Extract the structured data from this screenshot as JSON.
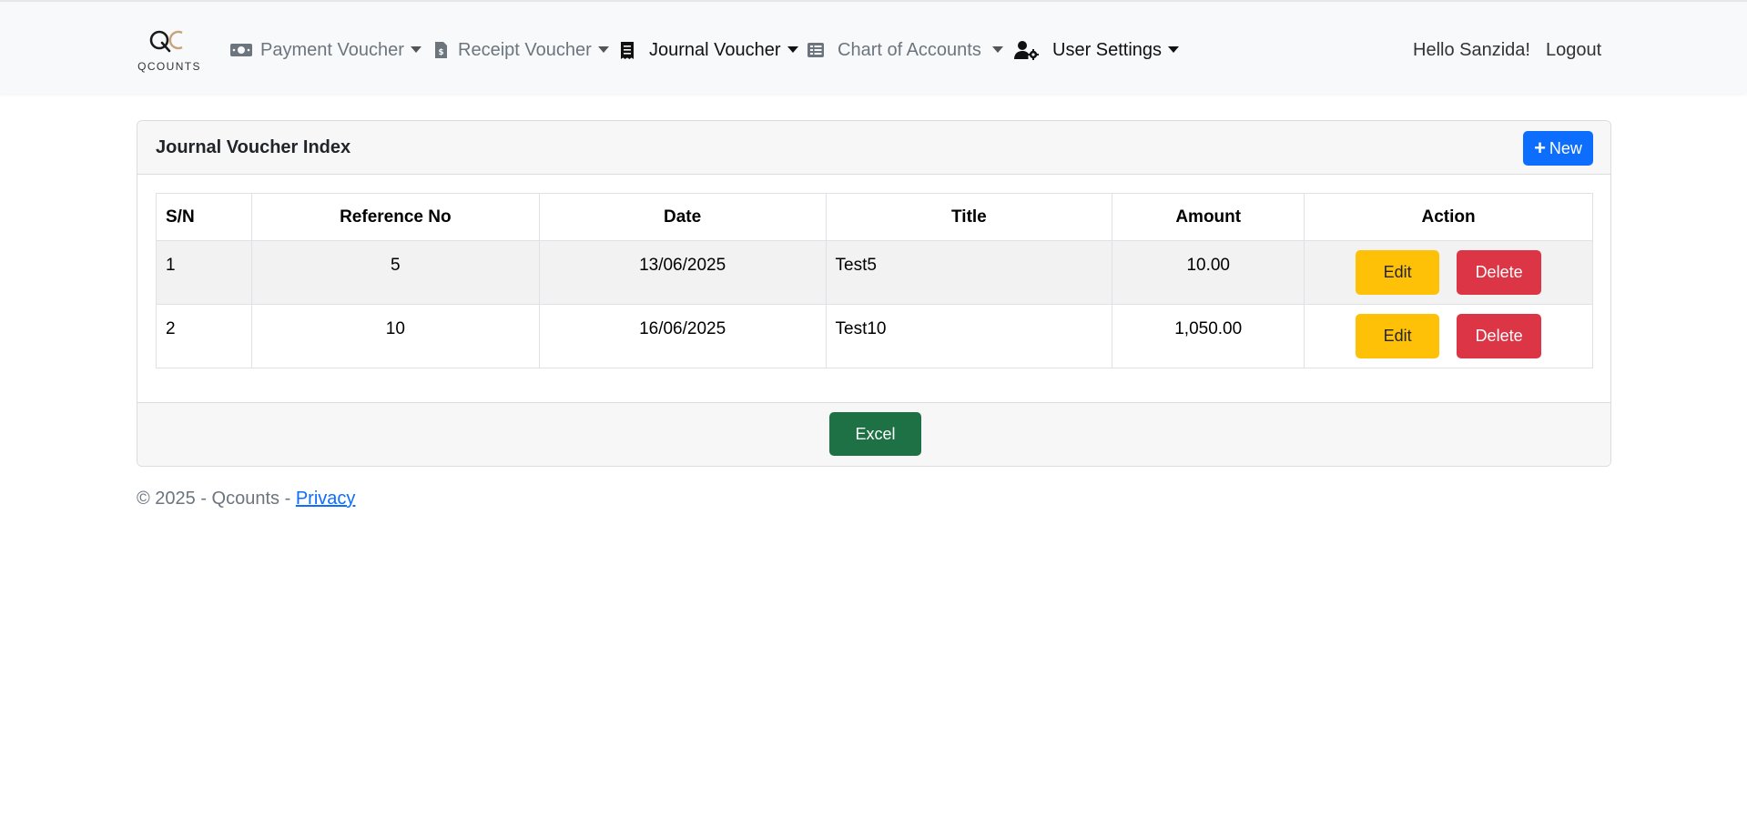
{
  "brand": {
    "name": "QCOUNTS"
  },
  "nav": {
    "items": [
      {
        "label": "Payment Voucher",
        "icon": "money-bill-icon"
      },
      {
        "label": "Receipt Voucher",
        "icon": "file-invoice-dollar-icon"
      },
      {
        "label": "Journal Voucher",
        "icon": "receipt-icon"
      },
      {
        "label": "Chart of Accounts",
        "icon": "list-table-icon"
      },
      {
        "label": "User Settings",
        "icon": "user-gear-icon"
      }
    ],
    "greeting": "Hello Sanzida!",
    "logout": "Logout"
  },
  "card": {
    "title": "Journal Voucher Index",
    "new_label": "New",
    "excel_label": "Excel"
  },
  "table": {
    "headers": [
      "S/N",
      "Reference No",
      "Date",
      "Title",
      "Amount",
      "Action"
    ],
    "rows": [
      {
        "sn": "1",
        "ref": "5",
        "date": "13/06/2025",
        "title": "Test5",
        "amount": "10.00"
      },
      {
        "sn": "2",
        "ref": "10",
        "date": "16/06/2025",
        "title": "Test10",
        "amount": "1,050.00"
      }
    ],
    "edit_label": "Edit",
    "delete_label": "Delete"
  },
  "footer": {
    "text": "© 2025 - Qcounts - ",
    "privacy": "Privacy"
  },
  "colors": {
    "primary": "#0d6efd",
    "warning": "#ffc107",
    "danger": "#dc3545",
    "excel": "#1e7145",
    "brand_accent": "#c8a27c"
  }
}
